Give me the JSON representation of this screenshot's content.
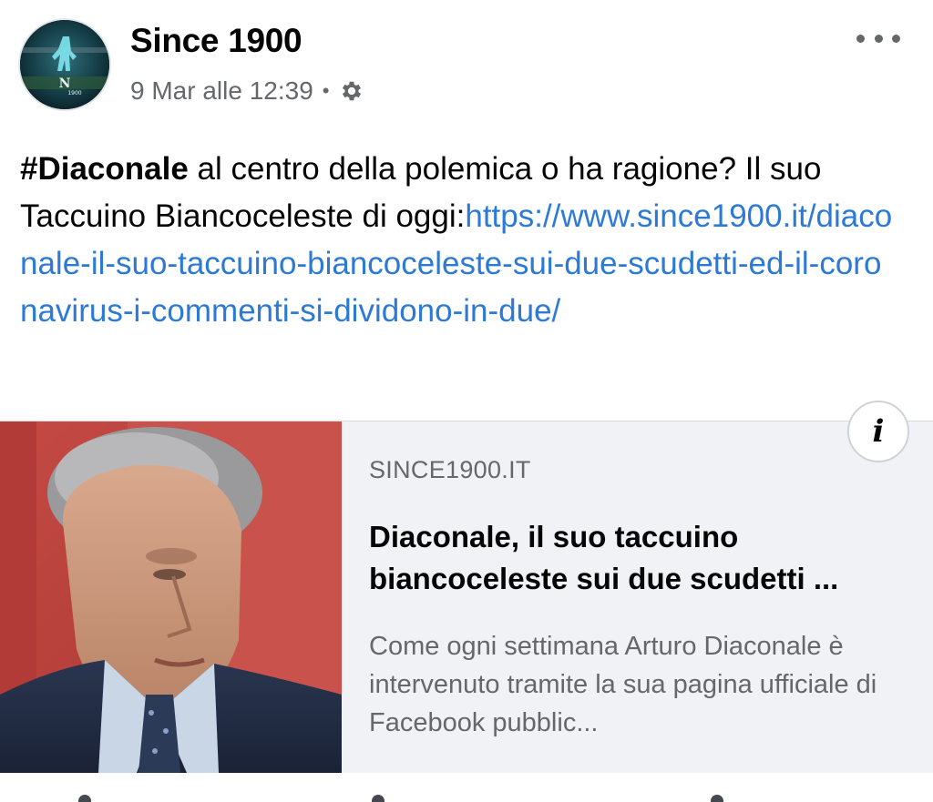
{
  "post": {
    "page_name": "Since 1900",
    "timestamp": "9 Mar alle 12:39",
    "separator": "•",
    "privacy_icon": "gear-icon",
    "more_icon": "more-options-icon",
    "text": {
      "hashtag": "#Diaconale",
      "body": " al centro della polemica o ha ragione? Il suo Taccuino Biancoceleste di oggi:",
      "link": "https://www.since1900.it/diaconale-il-suo-taccuino-biancoceleste-sui-due-scudetti-ed-il-coronavirus-i-commenti-si-dividono-in-due/"
    }
  },
  "link_preview": {
    "domain": "SINCE1900.IT",
    "title": "Diaconale, il suo taccuino biancoceleste sui due scudetti ...",
    "description": "Come ogni settimana Arturo Diaconale è intervenuto tramite la sua pagina ufficiale di Facebook pubblic...",
    "info_label": "i"
  },
  "colors": {
    "link": "#2d7ad6",
    "secondary_text": "#65676b",
    "card_bg": "#f0f2f5"
  }
}
